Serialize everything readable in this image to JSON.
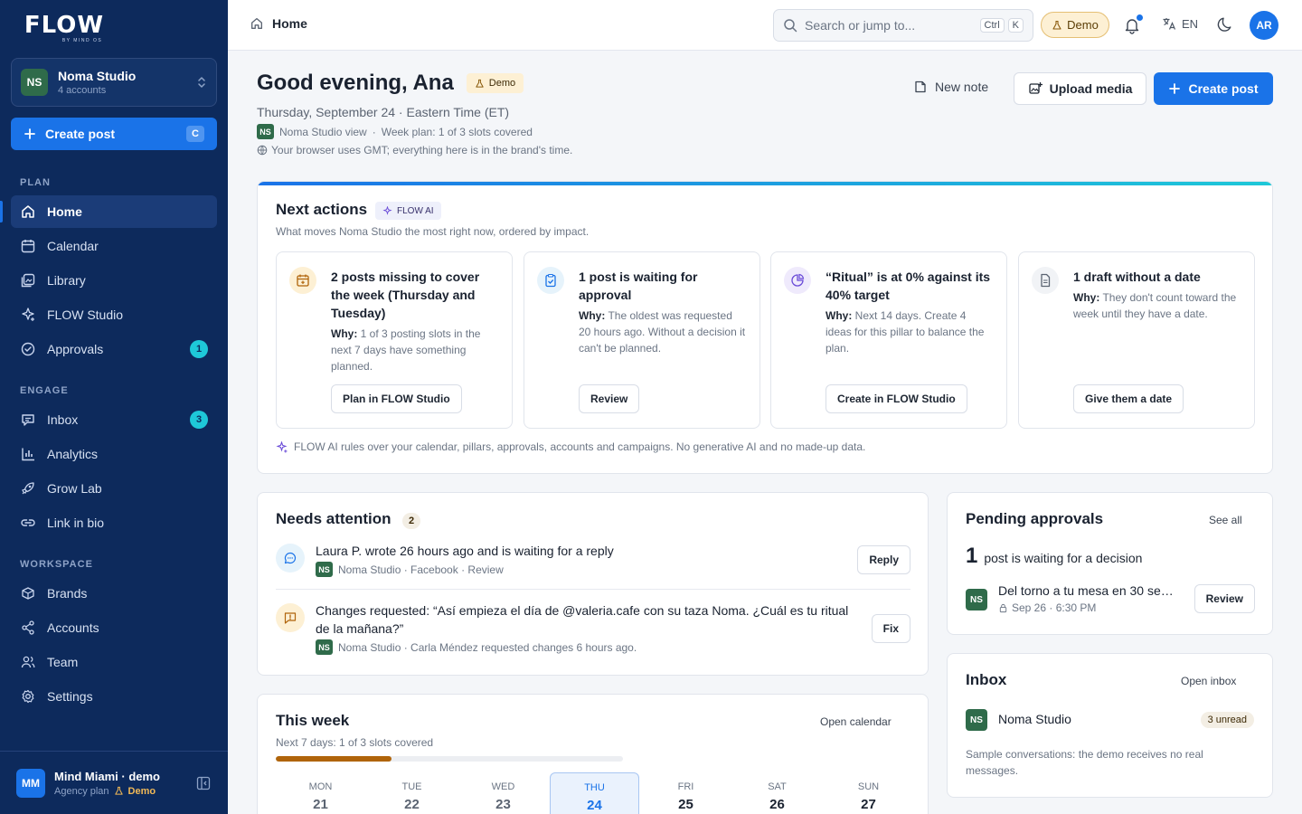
{
  "brand": {
    "logo": "FLOW",
    "logo_sub": "BY MIND OS"
  },
  "workspace": {
    "initials": "NS",
    "name": "Noma Studio",
    "accounts": "4 accounts"
  },
  "sidebar": {
    "create_label": "Create post",
    "create_shortcut": "C",
    "sections": {
      "plan": "PLAN",
      "engage": "ENGAGE",
      "workspace": "WORKSPACE"
    },
    "items": [
      {
        "label": "Home",
        "icon": "home-icon"
      },
      {
        "label": "Calendar",
        "icon": "calendar-icon"
      },
      {
        "label": "Library",
        "icon": "library-icon"
      },
      {
        "label": "FLOW Studio",
        "icon": "sparkle-icon"
      },
      {
        "label": "Approvals",
        "icon": "check-circle-icon",
        "badge": "1"
      },
      {
        "label": "Inbox",
        "icon": "inbox-icon",
        "badge": "3"
      },
      {
        "label": "Analytics",
        "icon": "bar-chart-icon"
      },
      {
        "label": "Grow Lab",
        "icon": "rocket-icon"
      },
      {
        "label": "Link in bio",
        "icon": "link-icon"
      },
      {
        "label": "Brands",
        "icon": "brands-icon"
      },
      {
        "label": "Accounts",
        "icon": "share-icon"
      },
      {
        "label": "Team",
        "icon": "team-icon"
      },
      {
        "label": "Settings",
        "icon": "gear-icon"
      }
    ],
    "footer": {
      "initials": "MM",
      "name": "Mind Miami · demo",
      "plan": "Agency plan",
      "demo": "Demo"
    }
  },
  "topbar": {
    "breadcrumb": "Home",
    "search_placeholder": "Search or jump to...",
    "kbd_ctrl": "Ctrl",
    "kbd_k": "K",
    "demo": "Demo",
    "lang": "EN",
    "user_initials": "AR"
  },
  "header": {
    "greeting": "Good evening, Ana",
    "demo_tag": "Demo",
    "date_line": "Thursday, September 24 · Eastern Time (ET)",
    "view_initials": "NS",
    "view_label": "Noma Studio view",
    "sep": "·",
    "week_plan": "Week plan: 1 of 3 slots covered",
    "tz_note": "Your browser uses GMT; everything here is in the brand's time.",
    "new_note": "New note",
    "upload_media": "Upload media",
    "create_post": "Create post"
  },
  "next_actions": {
    "title": "Next actions",
    "ai_tag": "FLOW AI",
    "subtitle": "What moves Noma Studio the most right now, ordered by impact.",
    "why_label": "Why:",
    "cards": [
      {
        "title": "2 posts missing to cover the week (Thursday and Tuesday)",
        "why": "1 of 3 posting slots in the next 7 days have something planned.",
        "button": "Plan in FLOW Studio",
        "icon": "calendar-plus-icon",
        "color": "#fdf0d4",
        "icon_color": "#b0640a"
      },
      {
        "title": "1 post is waiting for approval",
        "why": "The oldest was requested 20 hours ago. Without a decision it can't be planned.",
        "button": "Review",
        "icon": "clipboard-check-icon",
        "color": "#e6f3fb",
        "icon_color": "#1a73e8"
      },
      {
        "title": "“Ritual” is at 0% against its 40% target",
        "why": "Next 14 days. Create 4 ideas for this pillar to balance the plan.",
        "button": "Create in FLOW Studio",
        "icon": "pie-chart-icon",
        "color": "#efeafc",
        "icon_color": "#6a4bd8"
      },
      {
        "title": "1 draft without a date",
        "why": "They don't count toward the week until they have a date.",
        "button": "Give them a date",
        "icon": "document-icon",
        "color": "#f1f3f6",
        "icon_color": "#5b6472"
      }
    ],
    "footer": "FLOW AI rules over your calendar, pillars, approvals, accounts and campaigns. No generative AI and no made-up data."
  },
  "needs_attention": {
    "title": "Needs attention",
    "count": "2",
    "items": [
      {
        "text": "Laura P. wrote 26 hours ago and is waiting for a reply",
        "initials": "NS",
        "meta": "Noma Studio · Facebook · Review",
        "button": "Reply",
        "icon": "chat-icon"
      },
      {
        "text": "Changes requested: “Así empieza el día de @valeria.cafe con su taza Noma. ¿Cuál es tu ritual de la mañana?”",
        "initials": "NS",
        "meta": "Noma Studio · Carla Méndez requested changes 6 hours ago.",
        "button": "Fix",
        "icon": "message-alert-icon"
      }
    ]
  },
  "this_week": {
    "title": "This week",
    "link": "Open calendar",
    "subtitle": "Next 7 days: 1 of 3 slots covered",
    "progress": 0.333,
    "days": [
      {
        "name": "MON",
        "date": "21"
      },
      {
        "name": "TUE",
        "date": "22"
      },
      {
        "name": "WED",
        "date": "23"
      },
      {
        "name": "THU",
        "date": "24",
        "today": true
      },
      {
        "name": "FRI",
        "date": "25"
      },
      {
        "name": "SAT",
        "date": "26"
      },
      {
        "name": "SUN",
        "date": "27"
      }
    ]
  },
  "pending": {
    "title": "Pending approvals",
    "link": "See all",
    "count": "1",
    "count_text": "post is waiting for a decision",
    "item": {
      "initials": "NS",
      "title": "Del torno a tu mesa en 30 segundos",
      "meta": "Sep 26 · 6:30 PM",
      "button": "Review"
    }
  },
  "inbox": {
    "title": "Inbox",
    "link": "Open inbox",
    "initials": "NS",
    "brand": "Noma Studio",
    "unread": "3 unread",
    "note": "Sample conversations: the demo receives no real messages."
  }
}
